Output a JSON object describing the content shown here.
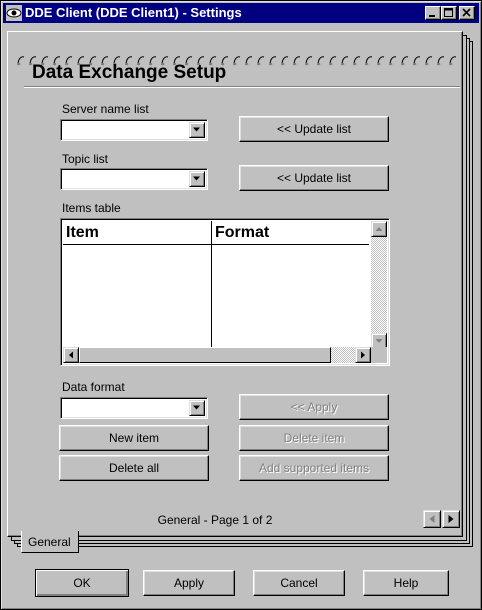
{
  "window": {
    "title": "DDE Client (DDE Client1) - Settings",
    "title_bar_color": "#000080",
    "controls": [
      "minimize-icon",
      "maximize-icon",
      "close-icon"
    ]
  },
  "page": {
    "heading": "Data Exchange Setup",
    "server_name_list": {
      "label": "Server name list",
      "value": "",
      "update_button": "<< Update list"
    },
    "topic_list": {
      "label": "Topic list",
      "value": "",
      "update_button": "<< Update list"
    },
    "items_table": {
      "label": "Items table",
      "columns": [
        "Item",
        "Format"
      ],
      "rows": []
    },
    "data_format": {
      "label": "Data format",
      "value": ""
    },
    "buttons": {
      "apply_format": "<< Apply",
      "new_item": "New item",
      "delete_item": "Delete item",
      "delete_all": "Delete all",
      "add_supported_items": "Add supported items"
    },
    "page_status": "General - Page 1 of 2"
  },
  "tabs": [
    {
      "label": "General",
      "selected": true
    }
  ],
  "dialog_buttons": {
    "ok": "OK",
    "apply": "Apply",
    "cancel": "Cancel",
    "help": "Help"
  }
}
